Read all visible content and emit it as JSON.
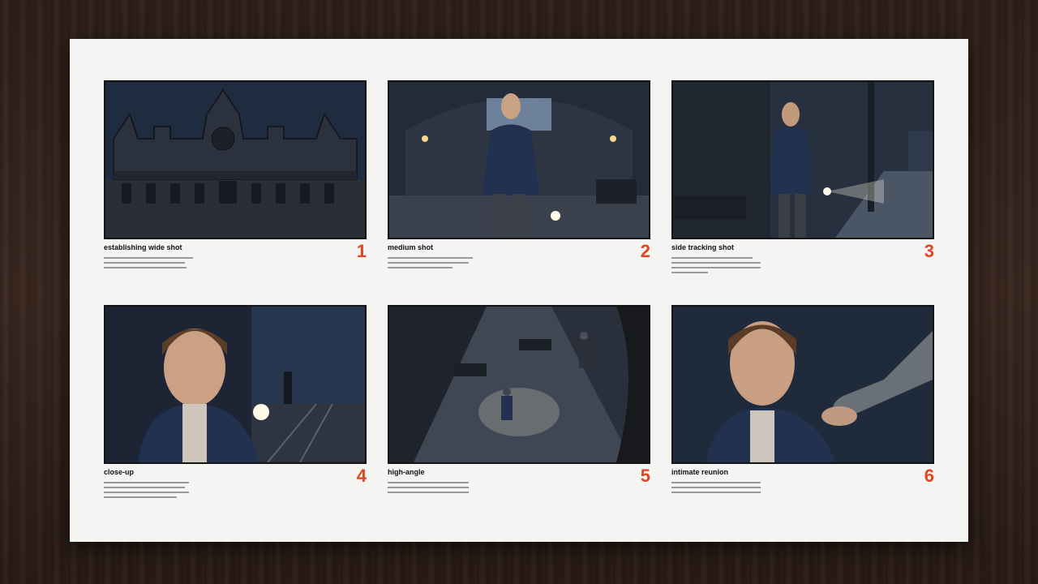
{
  "panels": [
    {
      "number": "1",
      "caption": "establishing wide shot",
      "image_icon": "train-station-exterior"
    },
    {
      "number": "2",
      "caption": "medium shot",
      "image_icon": "woman-with-flashlight"
    },
    {
      "number": "3",
      "caption": "side tracking shot",
      "image_icon": "woman-walking-platform"
    },
    {
      "number": "4",
      "caption": "close-up",
      "image_icon": "woman-closeup-flashlight"
    },
    {
      "number": "5",
      "caption": "high-angle",
      "image_icon": "two-figures-high-angle"
    },
    {
      "number": "6",
      "caption": "intimate reunion",
      "image_icon": "hand-on-shoulder"
    }
  ],
  "colors": {
    "accent": "#e0461f",
    "frame_border": "#141414",
    "sheet": "#f4f4f3"
  }
}
